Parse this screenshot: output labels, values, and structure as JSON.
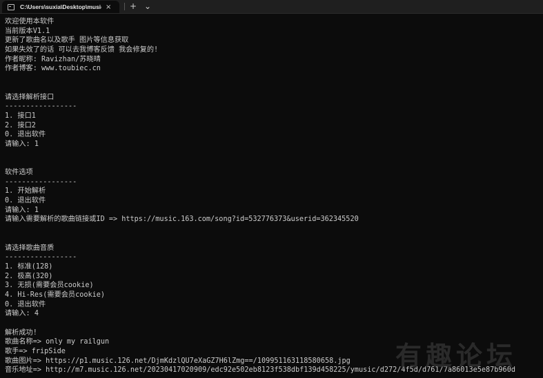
{
  "window": {
    "tab_title": "C:\\Users\\suxia\\Desktop\\music",
    "close_glyph": "×",
    "new_tab_glyph": "+",
    "dropdown_glyph": "⌄",
    "terminal_icon": "terminal-icon"
  },
  "console": {
    "lines": [
      "欢迎使用本软件",
      "当前版本V1.1",
      "更新了歌曲名以及歌手 图片等信息获取",
      "如果失效了的话 可以去我博客反馈 我会修复的!",
      "作者昵称: Ravizhan/苏晓晴",
      "作者博客: www.toubiec.cn",
      "",
      "",
      "请选择解析接口",
      "-----------------",
      "1. 接口1",
      "2. 接口2",
      "0. 退出软件",
      "请输入: 1",
      "",
      "",
      "软件选项",
      "-----------------",
      "1. 开始解析",
      "0. 退出软件",
      "请输入: 1",
      "请输入需要解析的歌曲链接或ID => https://music.163.com/song?id=532776373&userid=362345520",
      "",
      "",
      "请选择歌曲音质",
      "-----------------",
      "1. 标准(128)",
      "2. 极高(320)",
      "3. 无损(需要会员cookie)",
      "4. Hi-Res(需要会员cookie)",
      "0. 退出软件",
      "请输入: 4",
      "",
      "解析成功!",
      "歌曲名称=> only my railgun",
      "歌手=> fripSide",
      "歌曲图片=> https://p1.music.126.net/DjmKdzlQU7eXaGZ7H6lZmg==/109951163118580658.jpg",
      "音乐地址=> http://m7.music.126.net/20230417020909/edc92e502eb8123f538dbf139d458225/ymusic/d272/4f5d/d761/7a86013e5e87b960d"
    ]
  },
  "watermark": {
    "text": "有趣论坛"
  }
}
